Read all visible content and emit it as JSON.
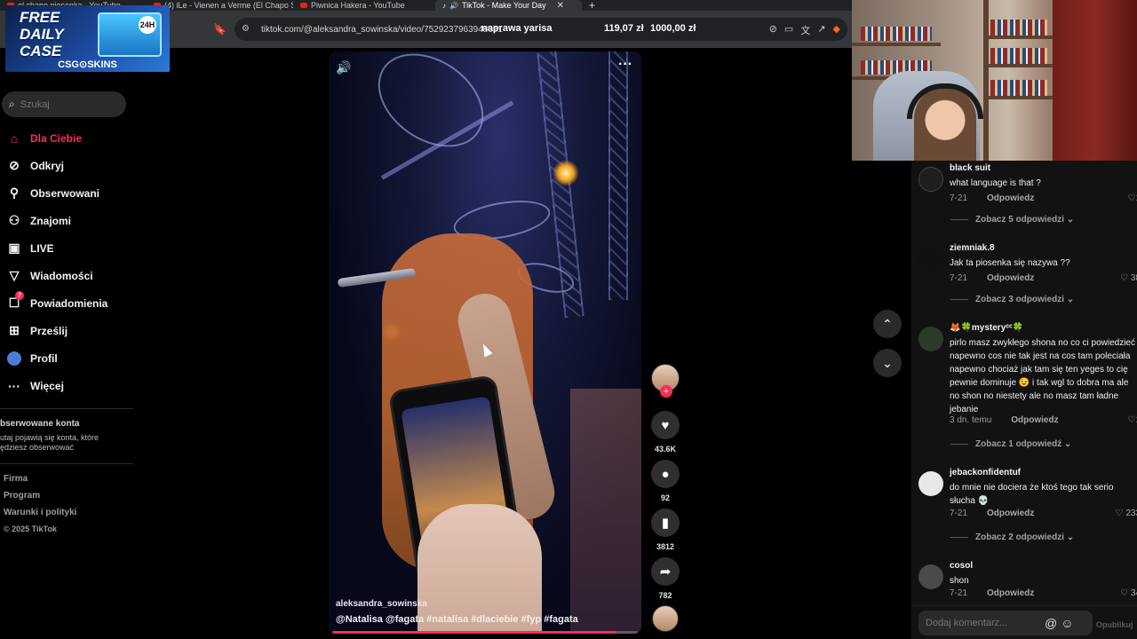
{
  "browser": {
    "tabs": [
      {
        "label": "el chapo piosenka - YouTube",
        "active": false
      },
      {
        "label": "(4) iLe - Vienen a Verme (El Chapo Sc",
        "active": false
      },
      {
        "label": "Piwnica Hakera - YouTube",
        "active": false
      },
      {
        "label": "TikTok - Make Your Day",
        "active": true
      }
    ],
    "new_tab": "+",
    "close_tab": "✕",
    "url": "tiktok.com/@aleksandra_sowinska/video/7529237963948051",
    "overlay_text_1": "naprawa yarisa",
    "overlay_text_2": "119,07 zł",
    "overlay_text_3": "1000,00 zł"
  },
  "ad": {
    "line1": "FREE",
    "line2": "DAILY",
    "line3": "CASE",
    "badge": "24H",
    "brand": "CSG⊙SKINS"
  },
  "tiktok": {
    "search_placeholder": "Szukaj",
    "nav": [
      {
        "label": "Dla Ciebie",
        "icon": "home-icon",
        "active": true
      },
      {
        "label": "Odkryj",
        "icon": "compass-icon",
        "active": false
      },
      {
        "label": "Obserwowani",
        "icon": "user-plus-icon",
        "active": false
      },
      {
        "label": "Znajomi",
        "icon": "friends-icon",
        "active": false
      },
      {
        "label": "LIVE",
        "icon": "live-icon",
        "active": false
      },
      {
        "label": "Wiadomości",
        "icon": "send-icon",
        "active": false
      },
      {
        "label": "Powiadomienia",
        "icon": "inbox-icon",
        "active": false,
        "badge": "7"
      },
      {
        "label": "Prześlij",
        "icon": "upload-icon",
        "active": false
      },
      {
        "label": "Profil",
        "icon": "profile-icon",
        "active": false
      },
      {
        "label": "Więcej",
        "icon": "more-icon",
        "active": false
      }
    ],
    "followed_title": "bserwowane konta",
    "followed_desc_1": "utaj pojawią się konta, które",
    "followed_desc_2": "ędziesz obserwować",
    "footer": [
      "Firma",
      "Program",
      "Warunki i polityki"
    ],
    "copyright": "© 2025 TikTok"
  },
  "video": {
    "author": "aleksandra_sowinska",
    "caption": "@Natalisa @fagata #natalisa #dlaciebie #fyp #fagata",
    "progress": 0.93,
    "likes": "43.6K",
    "comments": "92",
    "saves": "3812",
    "shares": "782"
  },
  "comments": [
    {
      "user": "black suit",
      "text": "what language is that ?",
      "date": "7-21",
      "reply_label": "Odpowiedz",
      "likes": "1",
      "more": "Zobacz 5 odpowiedzi"
    },
    {
      "user": "ziemniak.8",
      "text": "Jak ta piosenka się nazywa ??",
      "date": "7-21",
      "reply_label": "Odpowiedz",
      "likes": "38",
      "more": "Zobacz 3 odpowiedzi"
    },
    {
      "user": "🦊🍀mysteryᶜᶜ🍀",
      "text": "pirlo masz zwykłego shona no co ci powiedzieć napewno cos nie tak jest na cos tam poleciała napewno chociaż jak tam się ten yeges to cię pewnie dominuje 😉 i tak wgl to dobra ma ale no shon no niestety ale no masz tam ładne jebanie",
      "date": "3 dn. temu",
      "reply_label": "Odpowiedz",
      "likes": "1",
      "more": "Zobacz 1 odpowiedź"
    },
    {
      "user": "jebackonfidentuf",
      "text": "do mnie nie dociera że ktoś tego tak serio słucha 💀",
      "date": "7-21",
      "reply_label": "Odpowiedz",
      "likes": "233",
      "more": "Zobacz 2 odpowiedzi"
    },
    {
      "user": "cosol",
      "text": "shon",
      "date": "7-21",
      "reply_label": "Odpowiedz",
      "likes": "34"
    }
  ],
  "comment_input": {
    "placeholder": "Dodaj komentarz...",
    "post_label": "Opublikuj"
  },
  "colors": {
    "accent": "#fe2c55",
    "background": "#000000",
    "panel": "#121212"
  }
}
